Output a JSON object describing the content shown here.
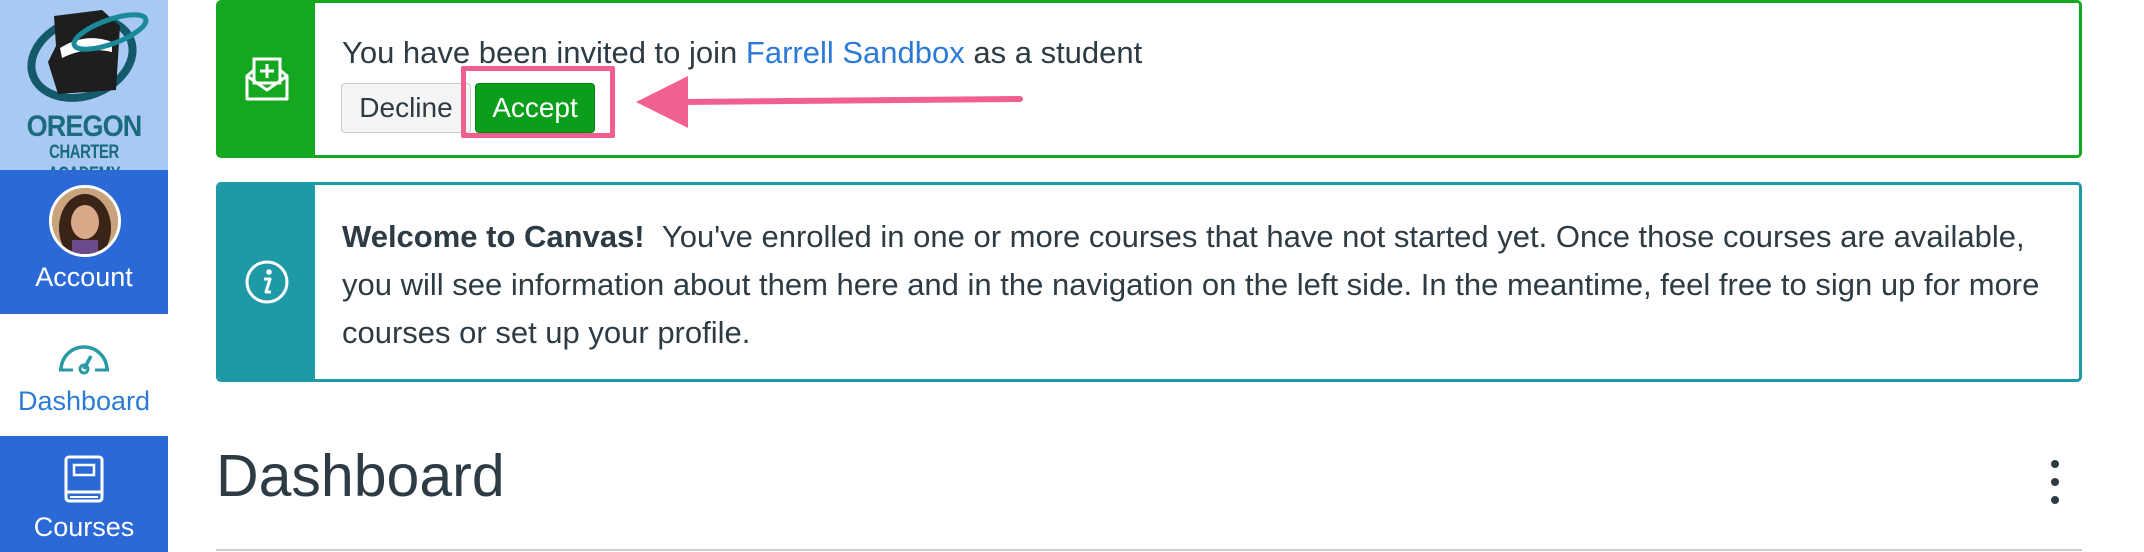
{
  "sidebar": {
    "logo": {
      "line1": "OREGON",
      "line2": "CHARTER ACADEMY"
    },
    "items": [
      {
        "label": "Account",
        "icon": "avatar"
      },
      {
        "label": "Dashboard",
        "icon": "dashboard-gauge-icon",
        "active": true
      },
      {
        "label": "Courses",
        "icon": "book-icon"
      }
    ]
  },
  "invite": {
    "text_before": "You have been invited to join ",
    "course_name": "Farrell Sandbox",
    "text_after": " as a student",
    "decline_label": "Decline",
    "accept_label": "Accept",
    "icon": "envelope-plus-icon"
  },
  "welcome": {
    "title": "Welcome to Canvas!",
    "body": "You've enrolled in one or more courses that have not started yet. Once those courses are available, you will see information about them here and in the navigation on the left side. In the meantime, feel free to sign up for more courses or set up your profile.",
    "icon": "info-icon"
  },
  "dashboard": {
    "title": "Dashboard",
    "options_icon": "more-vertical-icon"
  },
  "colors": {
    "sidebar_blue": "#2b6ad6",
    "logo_bg": "#a9c9f5",
    "success_green": "#14a820",
    "info_teal": "#1d9aa5",
    "highlight_pink": "#ef6090",
    "link_blue": "#2b7ad6"
  }
}
